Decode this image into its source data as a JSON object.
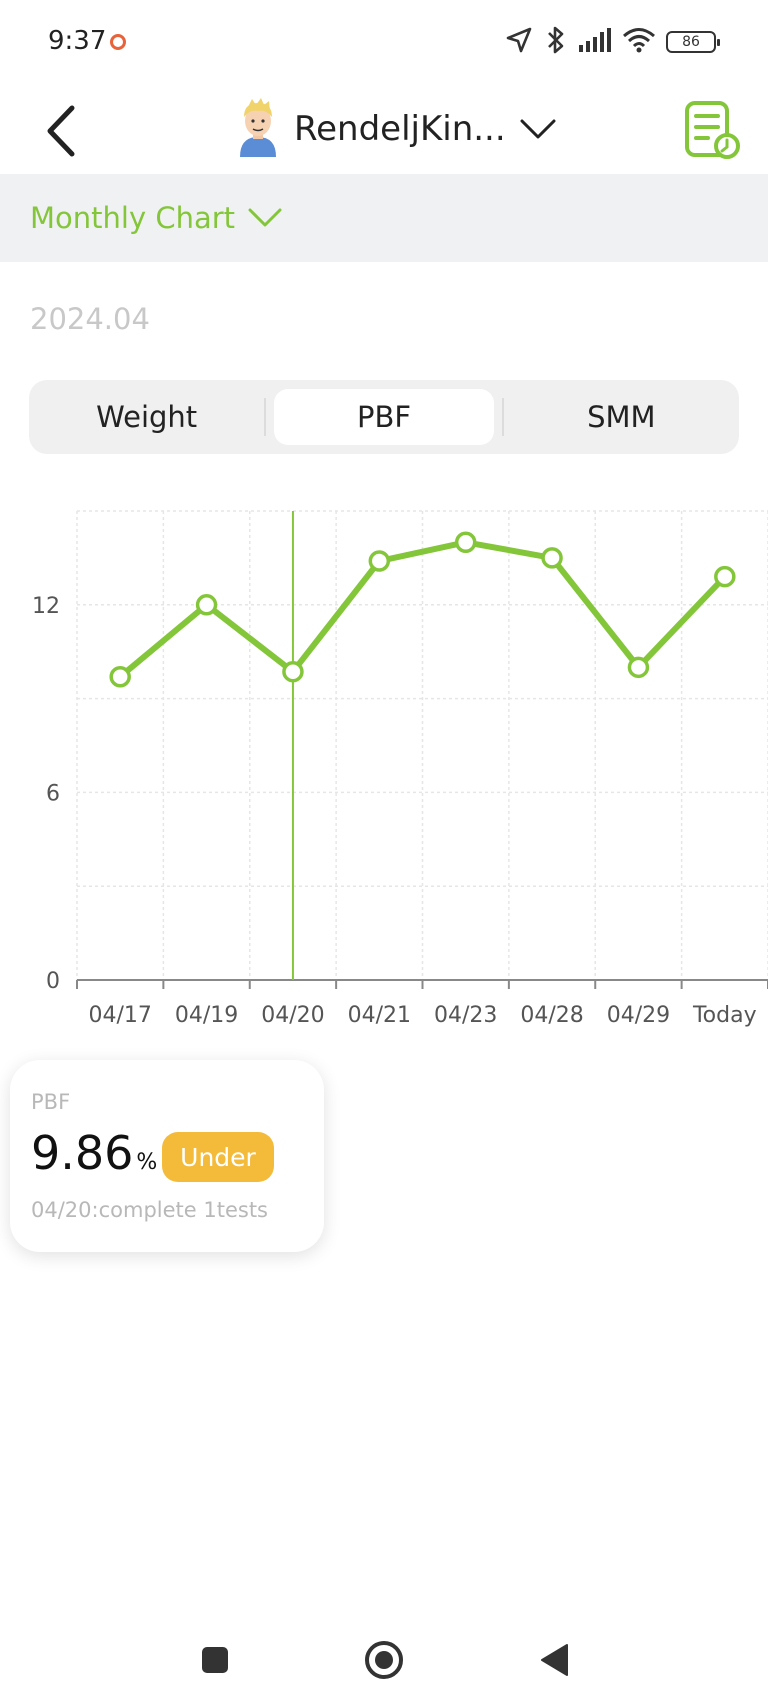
{
  "status_bar": {
    "time": "9:37",
    "battery": "86",
    "icons": [
      "location-icon",
      "bluetooth-icon",
      "signal-icon",
      "wifi-icon",
      "battery-icon"
    ]
  },
  "header": {
    "profile_name": "RendeljKin...",
    "icons": [
      "back-icon",
      "avatar",
      "chevron-down-icon",
      "record-list-icon"
    ]
  },
  "chart_type": {
    "label": "Monthly Chart"
  },
  "period": "2024.04",
  "tabs": [
    {
      "label": "Weight",
      "active": false
    },
    {
      "label": "PBF",
      "active": true
    },
    {
      "label": "SMM",
      "active": false
    }
  ],
  "colors": {
    "accent": "#84c63a",
    "badge": "#f4bb3b",
    "recording_dot": "#e8623a"
  },
  "chart_data": {
    "type": "line",
    "categories": [
      "04/17",
      "04/19",
      "04/20",
      "04/21",
      "04/23",
      "04/28",
      "04/29",
      "Today"
    ],
    "series": [
      {
        "values": [
          9.7,
          12.0,
          9.86,
          13.4,
          14.0,
          13.5,
          10.0,
          12.9
        ]
      }
    ],
    "yticks": [
      "12",
      "6",
      "0"
    ],
    "ylim": [
      0,
      15
    ],
    "grid": true,
    "highlight_category": "04/20"
  },
  "info_card": {
    "metric": "PBF",
    "value": "9.86",
    "unit": "%",
    "status": "Under",
    "detail": "04/20:complete 1tests"
  }
}
